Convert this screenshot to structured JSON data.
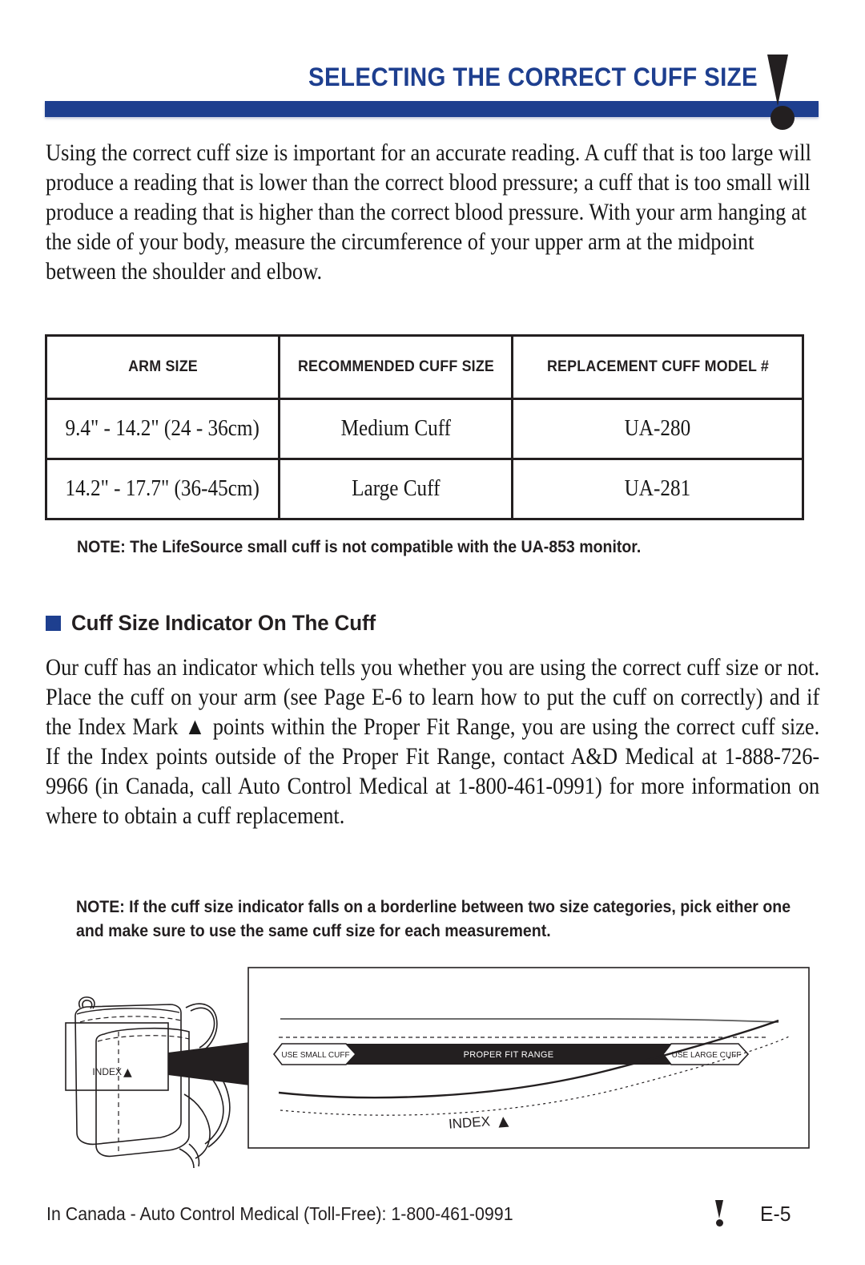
{
  "header": {
    "title": "SELECTING THE CORRECT CUFF SIZE",
    "accent_color": "#1e3f8f",
    "icon": "exclamation-mark-icon"
  },
  "intro_paragraph": "Using the correct cuff size is important for an accurate reading.  A cuff that is too large will produce a reading that is lower than the correct blood pressure; a cuff that is too small will produce a reading that is higher than the correct blood pressure.  With your arm hanging at the side of your body, measure the circumference of your upper arm at the midpoint between the shoulder and elbow.",
  "table": {
    "headers": [
      "ARM SIZE",
      "RECOMMENDED CUFF SIZE",
      "REPLACEMENT CUFF MODEL #"
    ],
    "rows": [
      {
        "arm_size": "9.4\" - 14.2\" (24 - 36cm)",
        "recommended_cuff_size": "Medium Cuff",
        "replacement_model": "UA-280"
      },
      {
        "arm_size": "14.2\" - 17.7\" (36-45cm)",
        "recommended_cuff_size": "Large Cuff",
        "replacement_model": "UA-281"
      }
    ]
  },
  "note_one": "NOTE: The LifeSource small cuff is not compatible with the UA-853 monitor.",
  "section": {
    "bullet_color": "#1e3f8f",
    "heading": "Cuff Size Indicator On The Cuff",
    "paragraph": "Our cuff has an indicator which tells you whether you are using the correct cuff size or not. Place the cuff on your arm (see Page E-6 to learn how to put the cuff on correctly) and if the Index Mark ▲ points within the Proper Fit Range, you are using the correct cuff size. If the Index points outside of the Proper Fit Range, contact A&D Medical at 1-888-726-9966 (in Canada, call Auto Control Medical at 1-800-461-0991) for more information on where to obtain a cuff replacement."
  },
  "note_two": "NOTE: If the cuff size indicator falls on a borderline between two size categories, pick either one and make sure to use the same cuff size for each measurement.",
  "illustration": {
    "cuff_index_label": "INDEX",
    "cuff_index_mark": "▲",
    "small_cuff_label": "USE SMALL CUFF",
    "proper_fit_label": "PROPER FIT RANGE",
    "large_cuff_label": "USE LARGE CUFF",
    "detail_index_label": "INDEX",
    "detail_index_mark": "▲"
  },
  "footer": {
    "contact": "In Canada - Auto Control Medical (Toll-Free): 1-800-461-0991",
    "page_number": "E-5",
    "icon": "exclamation-mark-icon"
  }
}
